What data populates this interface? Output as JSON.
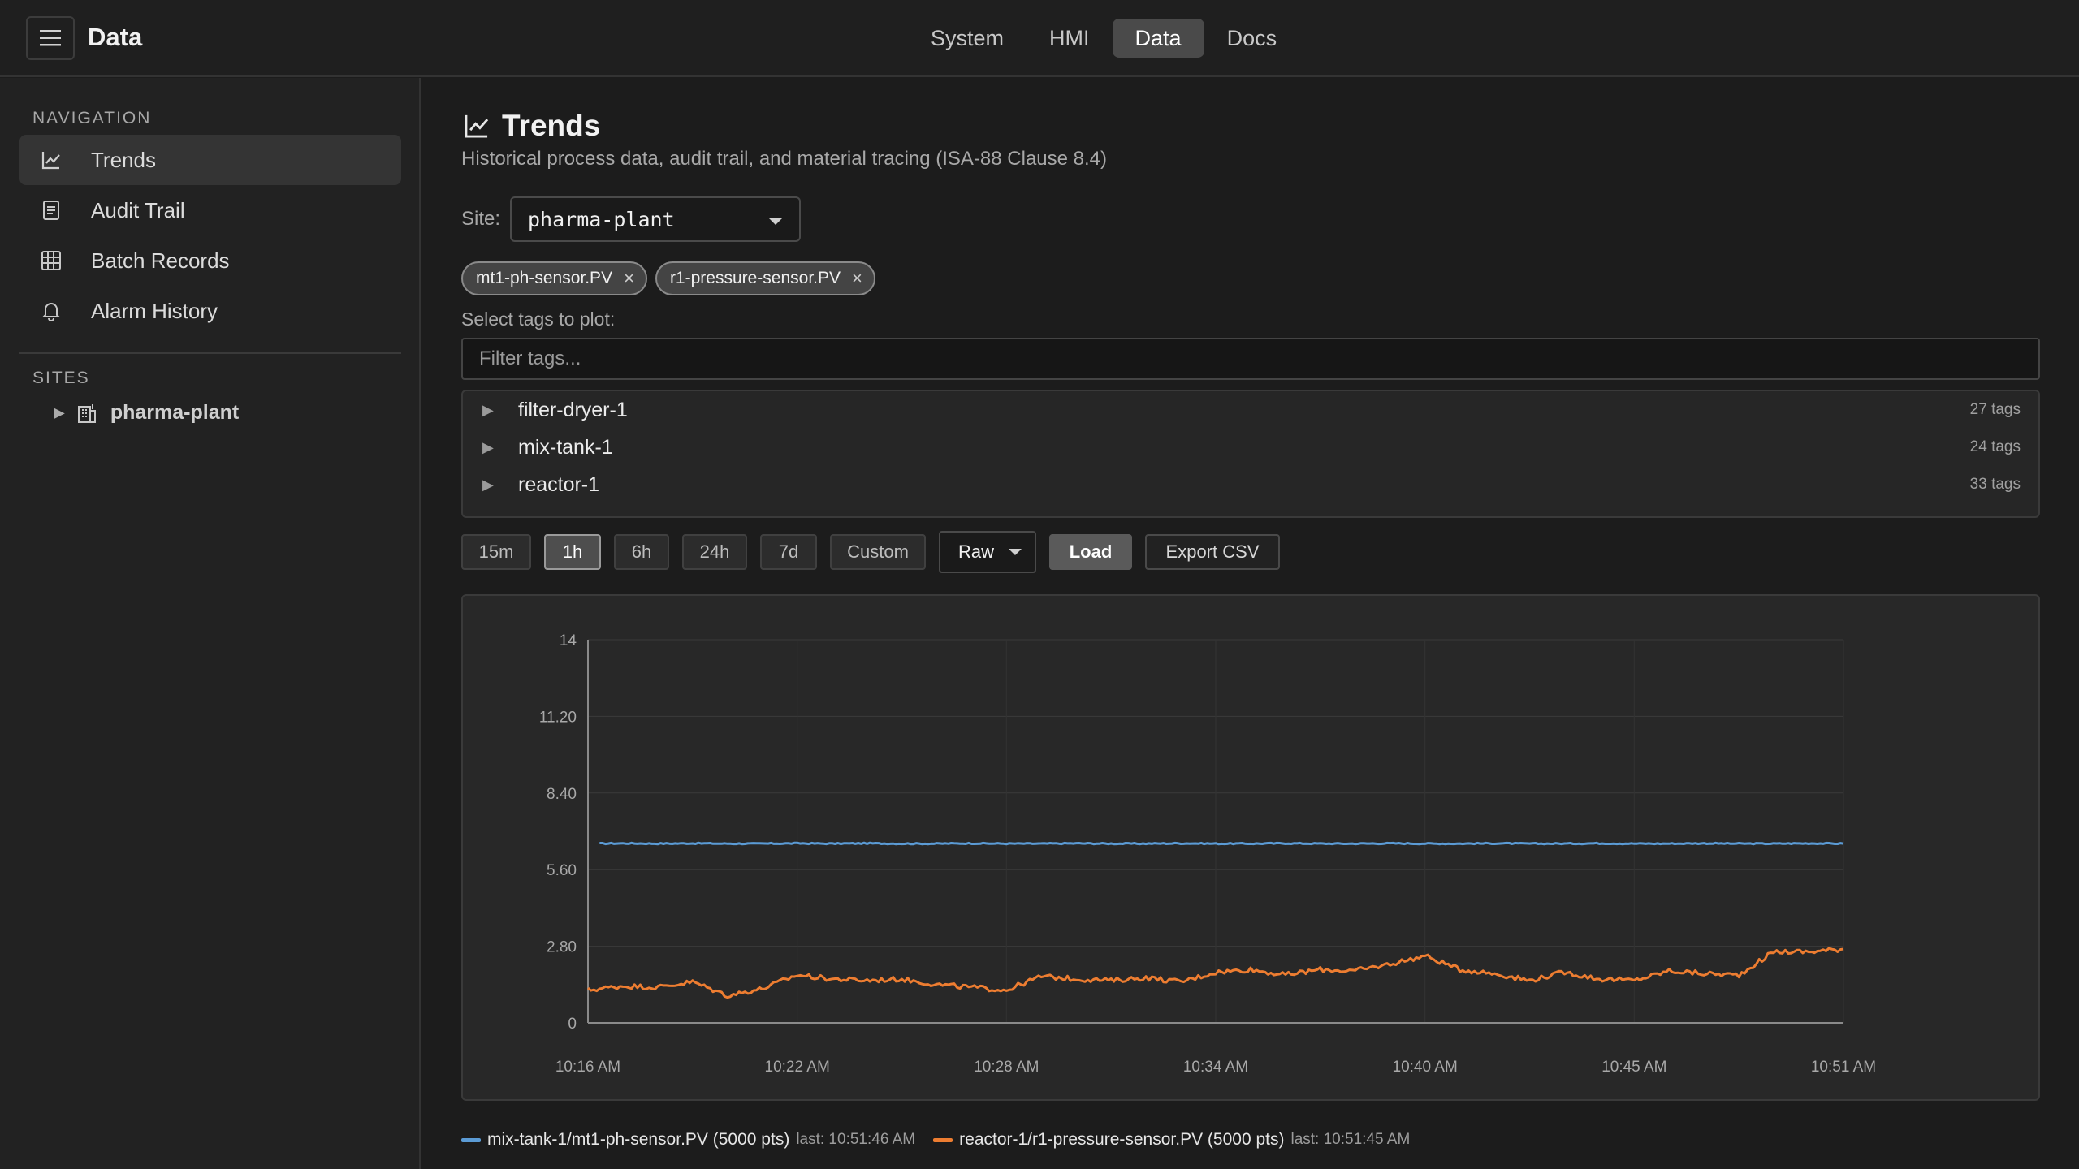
{
  "header": {
    "app_title": "Data",
    "tabs": [
      "System",
      "HMI",
      "Data",
      "Docs"
    ],
    "active_tab": "Data"
  },
  "sidebar": {
    "nav_label": "NAVIGATION",
    "items": [
      {
        "label": "Trends",
        "icon": "chart-line-icon",
        "active": true
      },
      {
        "label": "Audit Trail",
        "icon": "document-icon"
      },
      {
        "label": "Batch Records",
        "icon": "table-icon"
      },
      {
        "label": "Alarm History",
        "icon": "bell-icon"
      }
    ],
    "sites_label": "SITES",
    "sites": [
      {
        "label": "pharma-plant",
        "icon": "building-icon"
      }
    ]
  },
  "main": {
    "title": "Trends",
    "subtitle": "Historical process data, audit trail, and material tracing (ISA-88 Clause 8.4)",
    "site_label": "Site:",
    "site_value": "pharma-plant",
    "chips": [
      {
        "label": "mt1-ph-sensor.PV",
        "remove": "×"
      },
      {
        "label": "r1-pressure-sensor.PV",
        "remove": "×"
      }
    ],
    "tags_label": "Select tags to plot:",
    "filter_placeholder": "Filter tags...",
    "tree": [
      {
        "name": "filter-dryer-1",
        "count": "27 tags"
      },
      {
        "name": "mix-tank-1",
        "count": "24 tags"
      },
      {
        "name": "reactor-1",
        "count": "33 tags"
      }
    ],
    "ranges": [
      "15m",
      "1h",
      "6h",
      "24h",
      "7d",
      "Custom"
    ],
    "active_range": "1h",
    "mode": "Raw",
    "load_label": "Load",
    "export_label": "Export CSV"
  },
  "legend": [
    {
      "name": "mix-tank-1/mt1-ph-sensor.PV (5000 pts)",
      "last": "last: 10:51:46 AM",
      "color": "#5b9bd5"
    },
    {
      "name": "reactor-1/r1-pressure-sensor.PV (5000 pts)",
      "last": "last: 10:51:45 AM",
      "color": "#ed7d31"
    }
  ],
  "chart_data": {
    "type": "line",
    "title": "",
    "xlabel": "",
    "ylabel": "",
    "ylim": [
      0,
      14
    ],
    "y_ticks": [
      "0",
      "2.80",
      "5.60",
      "8.40",
      "11.20",
      "14"
    ],
    "x_ticks": [
      "10:16 AM",
      "10:22 AM",
      "10:28 AM",
      "10:34 AM",
      "10:40 AM",
      "10:45 AM",
      "10:51 AM"
    ],
    "grid": true,
    "x_minutes": [
      0,
      1,
      2,
      3,
      4,
      5,
      6,
      7,
      8,
      9,
      10,
      11,
      12,
      13,
      14,
      15,
      16,
      17,
      18,
      19,
      20,
      21,
      22,
      23,
      24,
      25,
      26,
      27,
      28,
      29,
      30,
      31,
      32,
      33,
      34,
      35,
      36
    ],
    "series": [
      {
        "name": "mix-tank-1/mt1-ph-sensor.PV",
        "color": "#5b9bd5",
        "values": [
          6.55,
          6.56,
          6.55,
          6.56,
          6.55,
          6.55,
          6.56,
          6.55,
          6.56,
          6.55,
          6.55,
          6.56,
          6.55,
          6.55,
          6.56,
          6.55,
          6.55,
          6.56,
          6.55,
          6.55,
          6.56,
          6.55,
          6.55,
          6.56,
          6.55,
          6.55,
          6.56,
          6.55,
          6.55,
          6.56,
          6.55,
          6.55,
          6.56,
          6.55,
          6.55,
          6.56,
          6.55
        ]
      },
      {
        "name": "reactor-1/r1-pressure-sensor.PV",
        "color": "#ed7d31",
        "values": [
          1.2,
          1.35,
          1.3,
          1.5,
          1.0,
          1.25,
          1.75,
          1.6,
          1.55,
          1.6,
          1.4,
          1.3,
          1.2,
          1.7,
          1.6,
          1.55,
          1.65,
          1.5,
          1.85,
          1.95,
          1.75,
          1.95,
          1.9,
          2.15,
          2.45,
          1.95,
          1.8,
          1.55,
          1.85,
          1.6,
          1.55,
          1.9,
          1.8,
          1.75,
          2.6,
          2.6,
          2.7
        ]
      }
    ]
  }
}
